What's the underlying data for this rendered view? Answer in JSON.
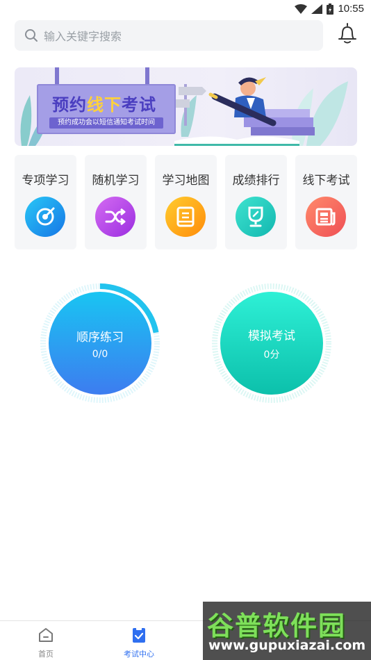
{
  "status_bar": {
    "time": "10:55"
  },
  "search": {
    "placeholder": "输入关键字搜索"
  },
  "banner": {
    "title_part1": "预约",
    "title_highlight": "线下",
    "title_part2": "考试",
    "subtitle": "预约成功会以短信通知考试时间"
  },
  "categories": [
    {
      "label": "专项学习",
      "icon": "target-icon"
    },
    {
      "label": "随机学习",
      "icon": "shuffle-icon"
    },
    {
      "label": "学习地图",
      "icon": "book-icon"
    },
    {
      "label": "成绩排行",
      "icon": "trophy-icon"
    },
    {
      "label": "线下考试",
      "icon": "newspaper-icon"
    }
  ],
  "practice": {
    "sequential": {
      "label": "顺序练习",
      "value": "0/0",
      "progress": 0.22
    },
    "mock_exam": {
      "label": "模拟考试",
      "value": "0分"
    }
  },
  "bottom_nav": [
    {
      "label": "首页",
      "active": false
    },
    {
      "label": "考试中心",
      "active": true
    }
  ],
  "watermark": {
    "brand": "谷普软件园",
    "url": "www.gupuxiazai.com"
  },
  "colors": {
    "accent": "#2f6ff0",
    "blue_circle": "#3d7cf0",
    "green_circle": "#0cc0ab"
  }
}
